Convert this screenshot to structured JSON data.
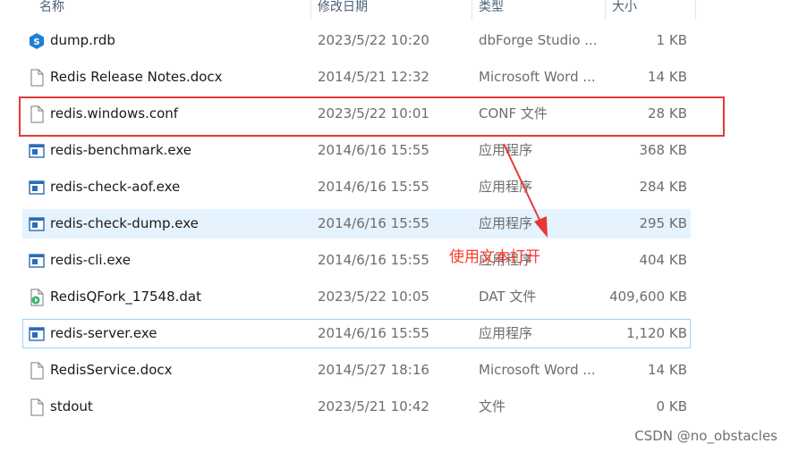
{
  "columns": {
    "name": "名称",
    "modified": "修改日期",
    "type": "类型",
    "size": "大小"
  },
  "files": [
    {
      "name": "dump.rdb",
      "modified": "2023/5/22 10:20",
      "type": "dbForge Studio ...",
      "size": "1 KB",
      "icon": "dbforge-icon"
    },
    {
      "name": "Redis Release Notes.docx",
      "modified": "2014/5/21 12:32",
      "type": "Microsoft Word ...",
      "size": "14 KB",
      "icon": "document-icon"
    },
    {
      "name": "redis.windows.conf",
      "modified": "2023/5/22 10:01",
      "type": "CONF 文件",
      "size": "28 KB",
      "icon": "document-icon"
    },
    {
      "name": "redis-benchmark.exe",
      "modified": "2014/6/16 15:55",
      "type": "应用程序",
      "size": "368 KB",
      "icon": "application-icon"
    },
    {
      "name": "redis-check-aof.exe",
      "modified": "2014/6/16 15:55",
      "type": "应用程序",
      "size": "284 KB",
      "icon": "application-icon"
    },
    {
      "name": "redis-check-dump.exe",
      "modified": "2014/6/16 15:55",
      "type": "应用程序",
      "size": "295 KB",
      "icon": "application-icon"
    },
    {
      "name": "redis-cli.exe",
      "modified": "2014/6/16 15:55",
      "type": "应用程序",
      "size": "404 KB",
      "icon": "application-icon"
    },
    {
      "name": "RedisQFork_17548.dat",
      "modified": "2023/5/22 10:05",
      "type": "DAT 文件",
      "size": "409,600 KB",
      "icon": "media-file-icon"
    },
    {
      "name": "redis-server.exe",
      "modified": "2014/6/16 15:55",
      "type": "应用程序",
      "size": "1,120 KB",
      "icon": "application-icon"
    },
    {
      "name": "RedisService.docx",
      "modified": "2014/5/27 18:16",
      "type": "Microsoft Word ...",
      "size": "14 KB",
      "icon": "document-icon"
    },
    {
      "name": "stdout",
      "modified": "2023/5/21 10:42",
      "type": "文件",
      "size": "0 KB",
      "icon": "document-icon"
    }
  ],
  "annotation": "使用文本打开",
  "watermark": "CSDN @no_obstacles",
  "colors": {
    "highlight": "#e53935",
    "annotation": "#ff3b2f",
    "hover_row": "#e5f3ff",
    "focus_border": "#99d1ff"
  }
}
